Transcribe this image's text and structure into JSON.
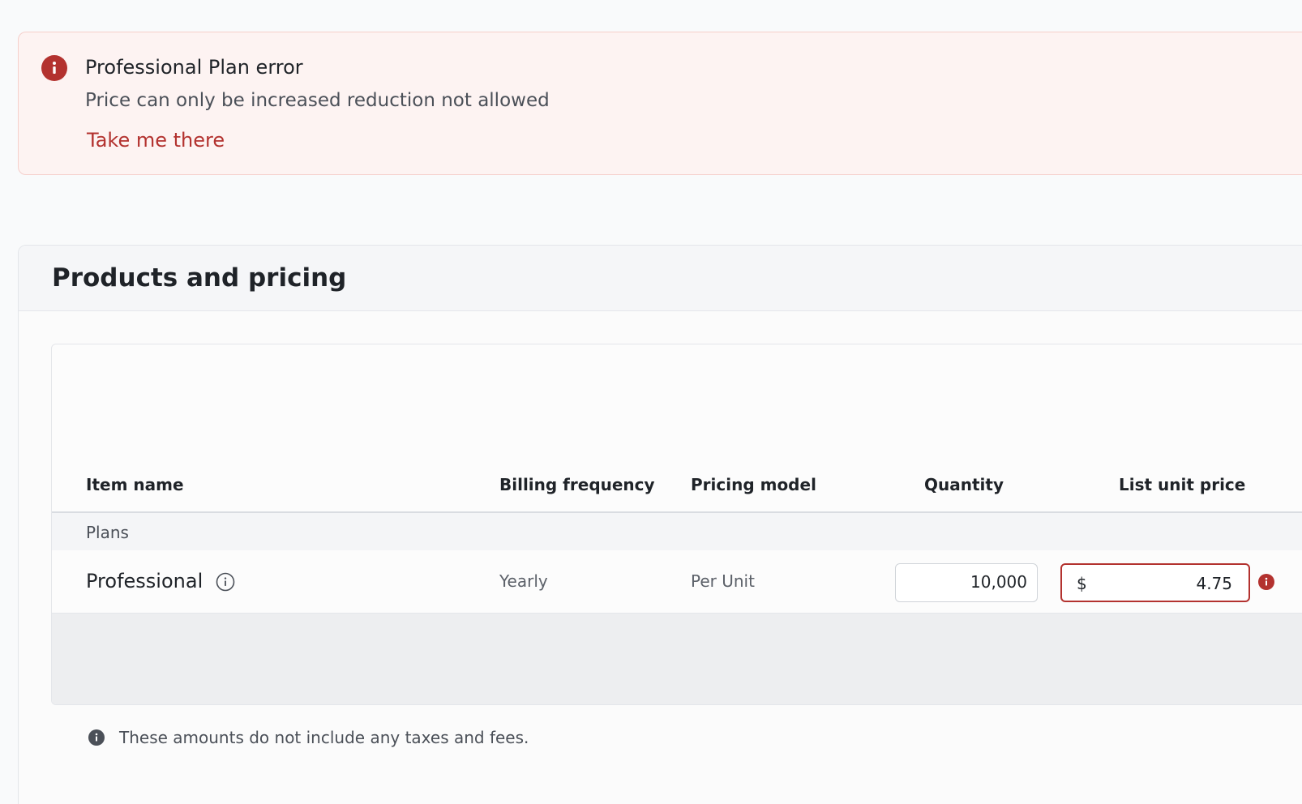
{
  "error_banner": {
    "title": "Professional Plan error",
    "message": "Price can only be increased reduction not allowed",
    "link_label": "Take me there",
    "icon": "error-info-icon",
    "accent_color": "#b3322f"
  },
  "products": {
    "title": "Products and pricing",
    "columns": {
      "item_name": "Item name",
      "billing_frequency": "Billing frequency",
      "pricing_model": "Pricing model",
      "quantity": "Quantity",
      "list_unit_price": "List unit price"
    },
    "groups": [
      {
        "label": "Plans",
        "rows": [
          {
            "item_name": "Professional",
            "billing_frequency": "Yearly",
            "pricing_model": "Per Unit",
            "quantity": "10,000",
            "currency": "$",
            "list_unit_price": "4.75",
            "next_field_prefix": "$"
          }
        ]
      }
    ],
    "tax_note": "These amounts do not include any taxes and fees."
  }
}
